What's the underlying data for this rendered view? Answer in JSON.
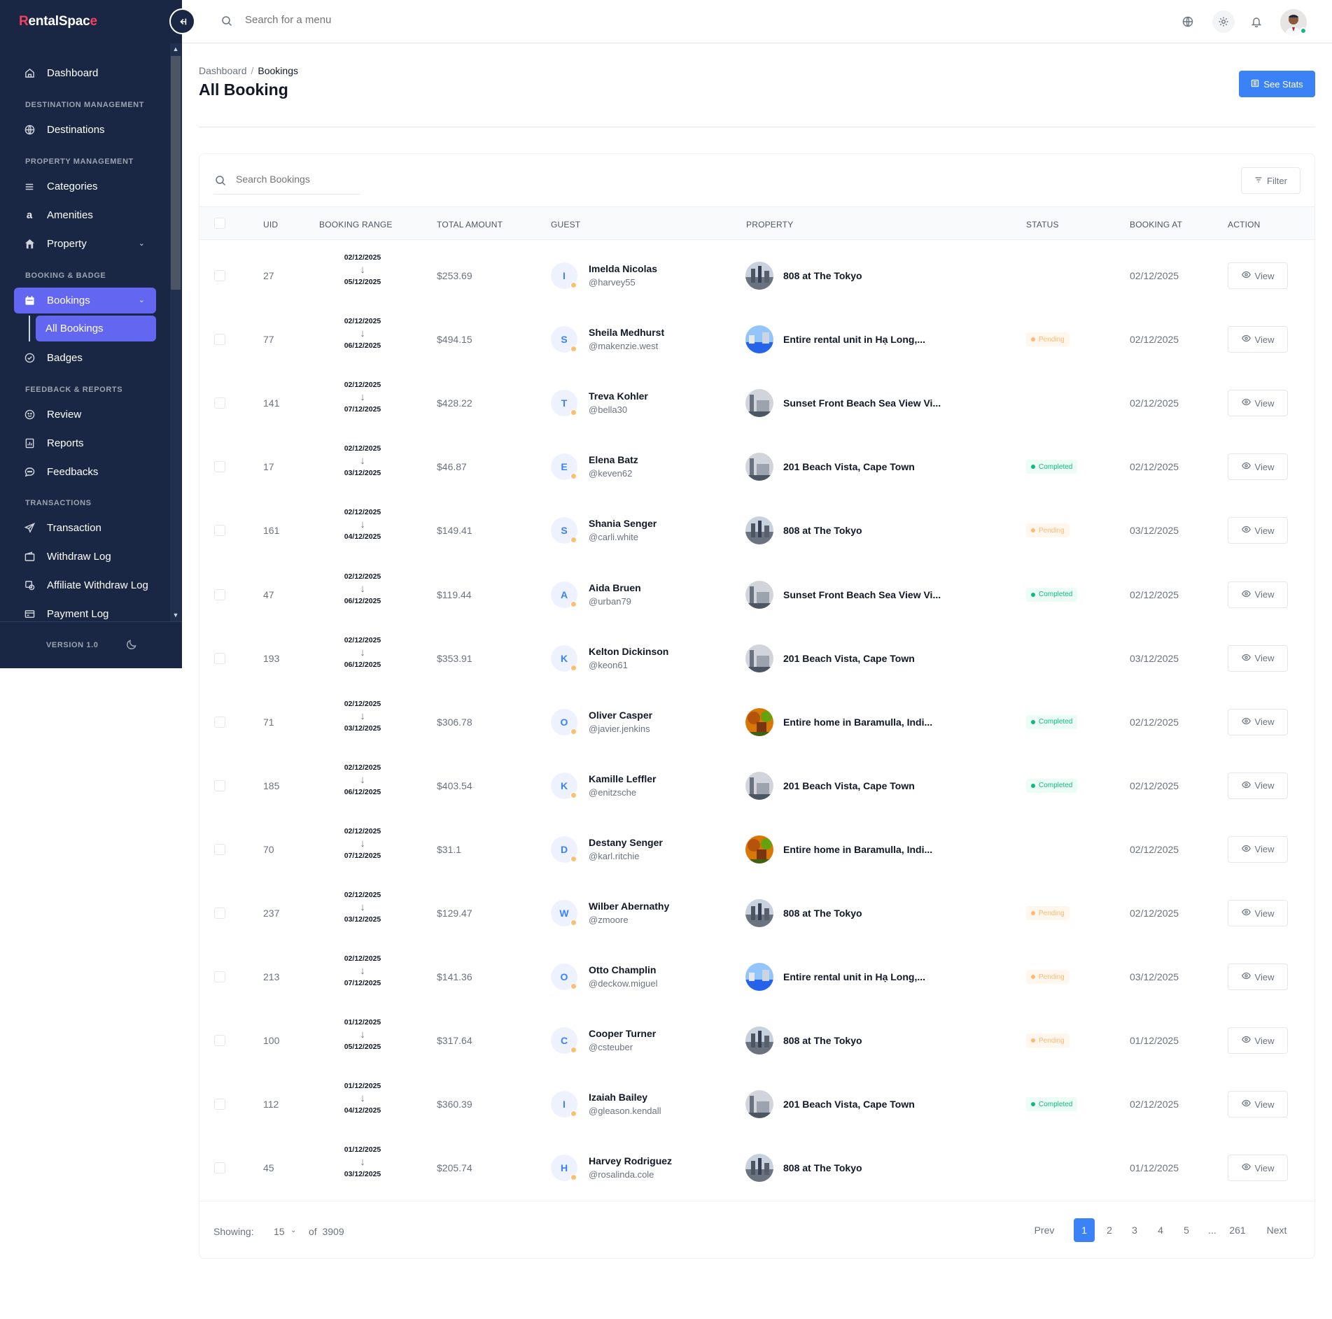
{
  "app": {
    "logo_first": "R",
    "logo_rest": "entalSpac",
    "logo_last": "e"
  },
  "sidebar": {
    "dashboard": "Dashboard",
    "sec_destination": "DESTINATION MANAGEMENT",
    "destinations": "Destinations",
    "sec_property": "PROPERTY MANAGEMENT",
    "categories": "Categories",
    "amenities": "Amenities",
    "property": "Property",
    "sec_booking": "BOOKING & BADGE",
    "bookings": "Bookings",
    "all_bookings": "All Bookings",
    "badges": "Badges",
    "sec_feedback": "FEEDBACK & REPORTS",
    "review": "Review",
    "reports": "Reports",
    "feedbacks": "Feedbacks",
    "sec_transactions": "TRANSACTIONS",
    "transaction": "Transaction",
    "withdraw_log": "Withdraw Log",
    "affiliate_withdraw_log": "Affiliate Withdraw Log",
    "payment_log": "Payment Log",
    "version": "VERSION 1.0"
  },
  "topbar": {
    "search_placeholder": "Search for a menu"
  },
  "page": {
    "breadcrumb_root": "Dashboard",
    "breadcrumb_sep": "/",
    "breadcrumb_current": "Bookings",
    "title": "All Booking",
    "see_stats": "See Stats"
  },
  "table": {
    "search_placeholder": "Search Bookings",
    "filter_label": "Filter",
    "headers": {
      "uid": "UID",
      "range": "BOOKING RANGE",
      "amount": "TOTAL AMOUNT",
      "guest": "GUEST",
      "property": "PROPERTY",
      "status": "STATUS",
      "booking_at": "BOOKING AT",
      "action": "ACTION"
    },
    "view_label": "View",
    "rows": [
      {
        "uid": "27",
        "from": "02/12/2025",
        "to": "05/12/2025",
        "amount": "$253.69",
        "initial": "I",
        "name": "Imelda Nicolas",
        "user": "@harvey55",
        "property": "808 at The Tokyo",
        "status": "",
        "status_type": "",
        "booked": "02/12/2025",
        "img": "sky"
      },
      {
        "uid": "77",
        "from": "02/12/2025",
        "to": "06/12/2025",
        "amount": "$494.15",
        "initial": "S",
        "name": "Sheila Medhurst",
        "user": "@makenzie.west",
        "property": "Entire rental unit in Hạ Long,...",
        "status": "Pending",
        "status_type": "pending",
        "booked": "02/12/2025",
        "img": "sea"
      },
      {
        "uid": "141",
        "from": "02/12/2025",
        "to": "07/12/2025",
        "amount": "$428.22",
        "initial": "T",
        "name": "Treva Kohler",
        "user": "@bella30",
        "property": "Sunset Front Beach Sea View Vi...",
        "status": "",
        "status_type": "",
        "booked": "02/12/2025",
        "img": "grey"
      },
      {
        "uid": "17",
        "from": "02/12/2025",
        "to": "03/12/2025",
        "amount": "$46.87",
        "initial": "E",
        "name": "Elena Batz",
        "user": "@keven62",
        "property": "201 Beach Vista, Cape Town",
        "status": "Completed",
        "status_type": "completed",
        "booked": "02/12/2025",
        "img": "grey"
      },
      {
        "uid": "161",
        "from": "02/12/2025",
        "to": "04/12/2025",
        "amount": "$149.41",
        "initial": "S",
        "name": "Shania Senger",
        "user": "@carli.white",
        "property": "808 at The Tokyo",
        "status": "Pending",
        "status_type": "pending",
        "booked": "03/12/2025",
        "img": "sky"
      },
      {
        "uid": "47",
        "from": "02/12/2025",
        "to": "06/12/2025",
        "amount": "$119.44",
        "initial": "A",
        "name": "Aida Bruen",
        "user": "@urban79",
        "property": "Sunset Front Beach Sea View Vi...",
        "status": "Completed",
        "status_type": "completed",
        "booked": "02/12/2025",
        "img": "grey"
      },
      {
        "uid": "193",
        "from": "02/12/2025",
        "to": "06/12/2025",
        "amount": "$353.91",
        "initial": "K",
        "name": "Kelton Dickinson",
        "user": "@keon61",
        "property": "201 Beach Vista, Cape Town",
        "status": "",
        "status_type": "",
        "booked": "03/12/2025",
        "img": "grey"
      },
      {
        "uid": "71",
        "from": "02/12/2025",
        "to": "03/12/2025",
        "amount": "$306.78",
        "initial": "O",
        "name": "Oliver Casper",
        "user": "@javier.jenkins",
        "property": "Entire home in Baramulla, Indi...",
        "status": "Completed",
        "status_type": "completed",
        "booked": "02/12/2025",
        "img": "autumn"
      },
      {
        "uid": "185",
        "from": "02/12/2025",
        "to": "06/12/2025",
        "amount": "$403.54",
        "initial": "K",
        "name": "Kamille Leffler",
        "user": "@enitzsche",
        "property": "201 Beach Vista, Cape Town",
        "status": "Completed",
        "status_type": "completed",
        "booked": "02/12/2025",
        "img": "grey"
      },
      {
        "uid": "70",
        "from": "02/12/2025",
        "to": "07/12/2025",
        "amount": "$31.1",
        "initial": "D",
        "name": "Destany Senger",
        "user": "@karl.ritchie",
        "property": "Entire home in Baramulla, Indi...",
        "status": "",
        "status_type": "",
        "booked": "02/12/2025",
        "img": "autumn"
      },
      {
        "uid": "237",
        "from": "02/12/2025",
        "to": "03/12/2025",
        "amount": "$129.47",
        "initial": "W",
        "name": "Wilber Abernathy",
        "user": "@zmoore",
        "property": "808 at The Tokyo",
        "status": "Pending",
        "status_type": "pending",
        "booked": "02/12/2025",
        "img": "sky"
      },
      {
        "uid": "213",
        "from": "02/12/2025",
        "to": "07/12/2025",
        "amount": "$141.36",
        "initial": "O",
        "name": "Otto Champlin",
        "user": "@deckow.miguel",
        "property": "Entire rental unit in Hạ Long,...",
        "status": "Pending",
        "status_type": "pending",
        "booked": "03/12/2025",
        "img": "sea"
      },
      {
        "uid": "100",
        "from": "01/12/2025",
        "to": "05/12/2025",
        "amount": "$317.64",
        "initial": "C",
        "name": "Cooper Turner",
        "user": "@csteuber",
        "property": "808 at The Tokyo",
        "status": "Pending",
        "status_type": "pending",
        "booked": "01/12/2025",
        "img": "sky"
      },
      {
        "uid": "112",
        "from": "01/12/2025",
        "to": "04/12/2025",
        "amount": "$360.39",
        "initial": "I",
        "name": "Izaiah Bailey",
        "user": "@gleason.kendall",
        "property": "201 Beach Vista, Cape Town",
        "status": "Completed",
        "status_type": "completed",
        "booked": "02/12/2025",
        "img": "grey"
      },
      {
        "uid": "45",
        "from": "01/12/2025",
        "to": "03/12/2025",
        "amount": "$205.74",
        "initial": "H",
        "name": "Harvey Rodriguez",
        "user": "@rosalinda.cole",
        "property": "808 at The Tokyo",
        "status": "",
        "status_type": "",
        "booked": "01/12/2025",
        "img": "sky"
      }
    ]
  },
  "pagination": {
    "showing_label": "Showing:",
    "per_page": "15",
    "of_label": "of",
    "total": "3909",
    "prev": "Prev",
    "pages": [
      "1",
      "2",
      "3",
      "4",
      "5",
      "...",
      "261"
    ],
    "active_page": "1",
    "next": "Next"
  },
  "colors": {
    "sidebar_bg": "#1a2744",
    "accent": "#6366f1",
    "primary": "#3b82f6",
    "pending": "#fdba74",
    "completed": "#10b981"
  }
}
